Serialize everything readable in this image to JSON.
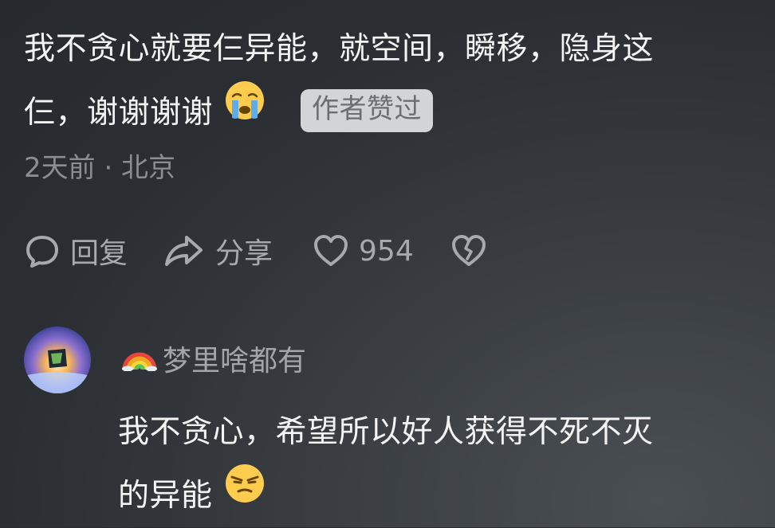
{
  "comment": {
    "text_line1": "我不贪心就要仨异能，就空间，瞬移，隐身这",
    "text_line2": "仨，谢谢谢谢",
    "emoji": "crying-face",
    "author_badge": "作者赞过",
    "meta": "2天前 · 北京"
  },
  "actions": {
    "reply_label": "回复",
    "share_label": "分享",
    "like_count": "954"
  },
  "reply": {
    "username": "梦里啥都有",
    "username_prefix_icon": "rainbow-icon",
    "text_line1": "我不贪心，希望所以好人获得不死不灭",
    "text_line2": "的异能",
    "emoji": "smirk-face"
  },
  "colors": {
    "background": "#2b2f33",
    "text_primary": "#f4f4f4",
    "text_secondary": "#8a8d91",
    "icon": "#a6a9ad",
    "badge_bg": "#d2d4d6",
    "badge_text": "#6b6e72",
    "emoji_yellow": "#ffcc4d"
  }
}
